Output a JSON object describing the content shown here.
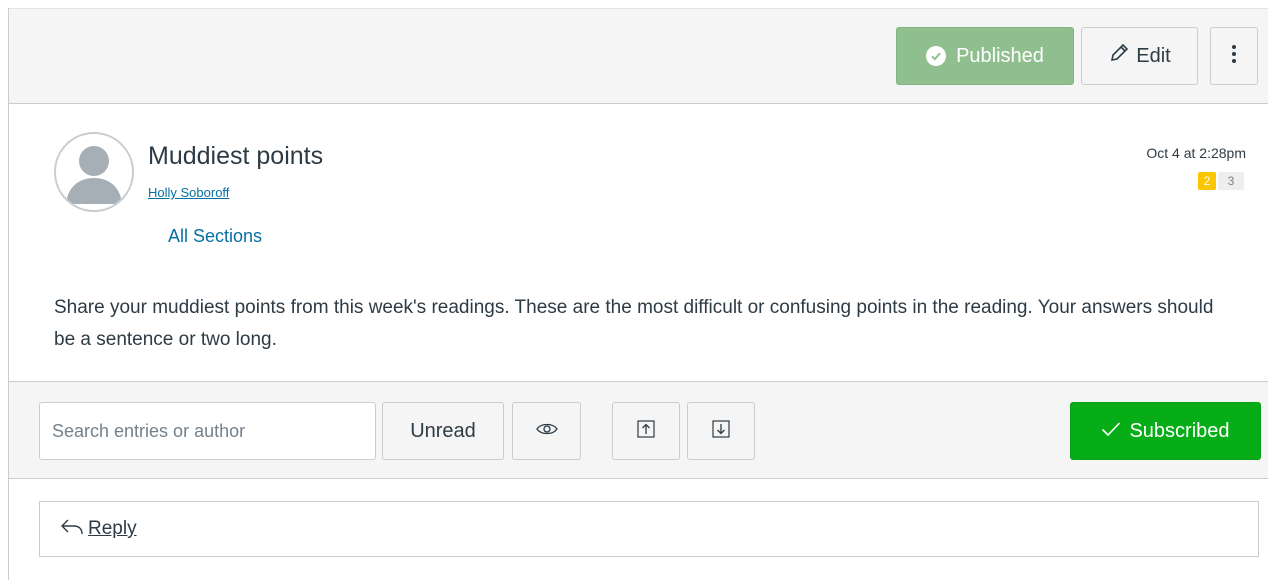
{
  "toolbar": {
    "published_label": "Published",
    "edit_label": "Edit"
  },
  "topic": {
    "title": "Muddiest points",
    "author": "Holly Soboroff",
    "sections": "All Sections",
    "date": "Oct 4 at 2:28pm",
    "unread_count": "2",
    "total_count": "3",
    "message": "Share your muddiest points from this week's readings. These are the most difficult or confusing points in the reading. Your answers should be a sentence or two long."
  },
  "filters": {
    "search_placeholder": "Search entries or author",
    "unread_label": "Unread",
    "subscribed_label": "Subscribed"
  },
  "reply": {
    "label": "Reply"
  },
  "colors": {
    "published_bg": "#8fbf8f",
    "subscribed_bg": "#06ad17",
    "link": "#0770a3",
    "unread_badge": "#fcc501"
  },
  "icons": [
    "check-circle-icon",
    "pencil-icon",
    "kebab-icon",
    "eye-icon",
    "collapse-all-icon",
    "expand-all-icon",
    "checkmark-icon",
    "reply-arrow-icon"
  ]
}
